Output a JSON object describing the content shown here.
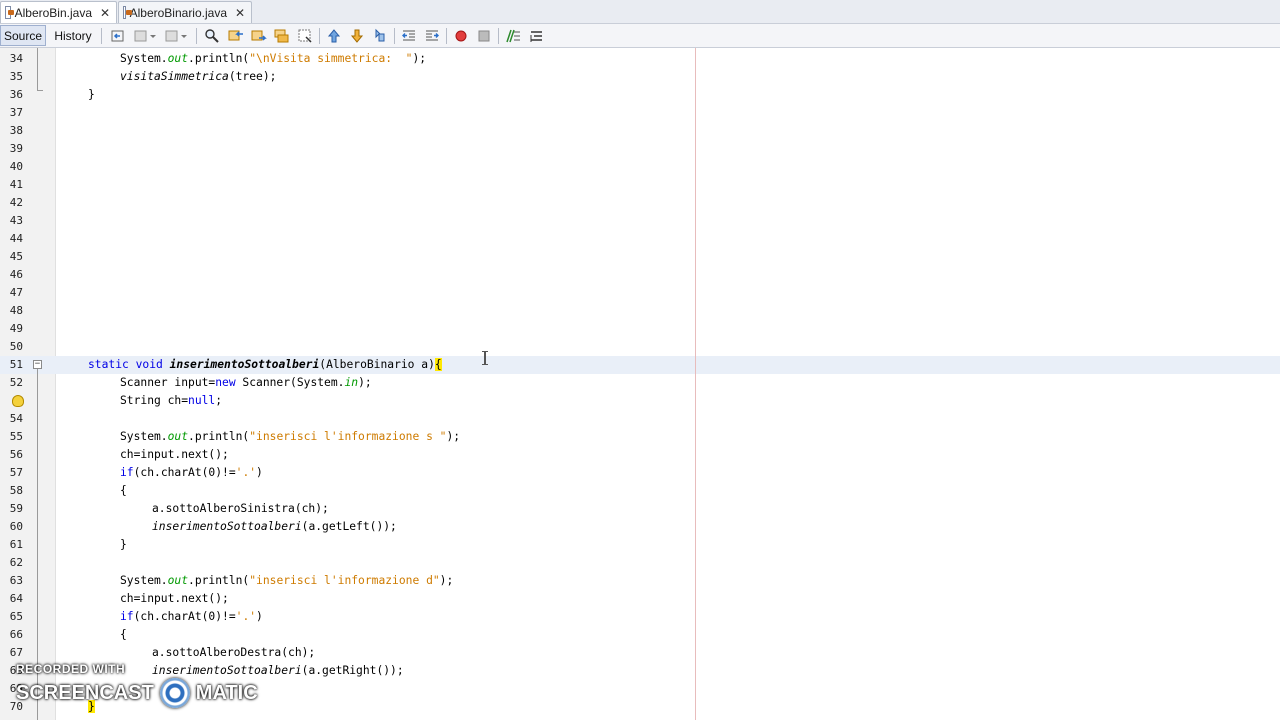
{
  "tabs": [
    {
      "label": "AlberoBin.java",
      "active": true
    },
    {
      "label": "AlberoBinario.java",
      "active": false
    }
  ],
  "toolbar": {
    "views": [
      "Source",
      "History"
    ],
    "active_view": "Source",
    "icons": [
      "last-edit-icon",
      "back-icon",
      "forward-icon",
      "find-icon",
      "find-previous-icon",
      "find-next-icon",
      "find-selection-icon",
      "toggle-highlight-icon",
      "previous-bookmark-icon",
      "next-bookmark-icon",
      "toggle-bookmark-icon",
      "shift-left-icon",
      "shift-right-icon",
      "start-macro-icon",
      "stop-macro-icon",
      "comment-icon",
      "uncomment-icon"
    ]
  },
  "editor": {
    "current_line": 51,
    "lines": [
      {
        "n": "34",
        "indent": 8,
        "parts": [
          [
            "System.",
            ""
          ],
          [
            "out",
            "fld"
          ],
          [
            ".println(",
            ""
          ],
          [
            "\"\\nVisita simmetrica:  \"",
            "str"
          ],
          [
            ");",
            ""
          ]
        ]
      },
      {
        "n": "35",
        "indent": 8,
        "parts": [
          [
            "visitaSimmetrica",
            "mth"
          ],
          [
            "(tree);",
            ""
          ]
        ]
      },
      {
        "n": "36",
        "indent": 4,
        "parts": [
          [
            "}",
            ""
          ]
        ]
      },
      {
        "n": "37",
        "indent": 0,
        "parts": []
      },
      {
        "n": "38",
        "indent": 0,
        "parts": []
      },
      {
        "n": "39",
        "indent": 0,
        "parts": []
      },
      {
        "n": "40",
        "indent": 0,
        "parts": []
      },
      {
        "n": "41",
        "indent": 0,
        "parts": []
      },
      {
        "n": "42",
        "indent": 0,
        "parts": []
      },
      {
        "n": "43",
        "indent": 0,
        "parts": []
      },
      {
        "n": "44",
        "indent": 0,
        "parts": []
      },
      {
        "n": "45",
        "indent": 0,
        "parts": []
      },
      {
        "n": "46",
        "indent": 0,
        "parts": []
      },
      {
        "n": "47",
        "indent": 0,
        "parts": []
      },
      {
        "n": "48",
        "indent": 0,
        "parts": []
      },
      {
        "n": "49",
        "indent": 0,
        "parts": []
      },
      {
        "n": "50",
        "indent": 0,
        "parts": []
      },
      {
        "n": "51",
        "indent": 4,
        "parts": [
          [
            "static void ",
            "kw"
          ],
          [
            "inserimentoSottoalberi",
            "mdecl"
          ],
          [
            "(AlberoBinario a)",
            ""
          ],
          [
            "{",
            "brace-hl"
          ]
        ]
      },
      {
        "n": "52",
        "indent": 8,
        "parts": [
          [
            "Scanner input=",
            ""
          ],
          [
            "new",
            "kw"
          ],
          [
            " Scanner(System.",
            ""
          ],
          [
            "in",
            "fld"
          ],
          [
            ");",
            ""
          ]
        ]
      },
      {
        "n": "",
        "indent": 8,
        "parts": [
          [
            "String ch=",
            ""
          ],
          [
            "null",
            "kw"
          ],
          [
            ";",
            ""
          ]
        ]
      },
      {
        "n": "54",
        "indent": 0,
        "parts": []
      },
      {
        "n": "55",
        "indent": 8,
        "parts": [
          [
            "System.",
            ""
          ],
          [
            "out",
            "fld"
          ],
          [
            ".println(",
            ""
          ],
          [
            "\"inserisci l'informazione s \"",
            "str"
          ],
          [
            ");",
            ""
          ]
        ]
      },
      {
        "n": "56",
        "indent": 8,
        "parts": [
          [
            "ch=input.next();",
            ""
          ]
        ]
      },
      {
        "n": "57",
        "indent": 8,
        "parts": [
          [
            "if",
            "kw"
          ],
          [
            "(ch.charAt(0)!=",
            ""
          ],
          [
            "'.'",
            "str"
          ],
          [
            ")",
            ""
          ]
        ]
      },
      {
        "n": "58",
        "indent": 8,
        "parts": [
          [
            "{",
            ""
          ]
        ]
      },
      {
        "n": "59",
        "indent": 12,
        "parts": [
          [
            "a.sottoAlberoSinistra(ch);",
            ""
          ]
        ]
      },
      {
        "n": "60",
        "indent": 12,
        "parts": [
          [
            "inserimentoSottoalberi",
            "mth"
          ],
          [
            "(a.getLeft());",
            ""
          ]
        ]
      },
      {
        "n": "61",
        "indent": 8,
        "parts": [
          [
            "}",
            ""
          ]
        ]
      },
      {
        "n": "62",
        "indent": 0,
        "parts": []
      },
      {
        "n": "63",
        "indent": 8,
        "parts": [
          [
            "System.",
            ""
          ],
          [
            "out",
            "fld"
          ],
          [
            ".println(",
            ""
          ],
          [
            "\"inserisci l'informazione d\"",
            "str"
          ],
          [
            ");",
            ""
          ]
        ]
      },
      {
        "n": "64",
        "indent": 8,
        "parts": [
          [
            "ch=input.next();",
            ""
          ]
        ]
      },
      {
        "n": "65",
        "indent": 8,
        "parts": [
          [
            "if",
            "kw"
          ],
          [
            "(ch.charAt(0)!=",
            ""
          ],
          [
            "'.'",
            "str"
          ],
          [
            ")",
            ""
          ]
        ]
      },
      {
        "n": "66",
        "indent": 8,
        "parts": [
          [
            "{",
            ""
          ]
        ]
      },
      {
        "n": "67",
        "indent": 12,
        "parts": [
          [
            "a.sottoAlberoDestra(ch);",
            ""
          ]
        ]
      },
      {
        "n": "68",
        "indent": 12,
        "parts": [
          [
            "inserimentoSottoalberi",
            "mth"
          ],
          [
            "(a.getRight());",
            ""
          ]
        ]
      },
      {
        "n": "69",
        "indent": 8,
        "parts": []
      },
      {
        "n": "70",
        "indent": 4,
        "parts": [
          [
            "}",
            "brace-hl"
          ]
        ]
      }
    ]
  },
  "watermark": {
    "line1": "RECORDED WITH",
    "left": "SCREENCAST",
    "right": "MATIC"
  }
}
